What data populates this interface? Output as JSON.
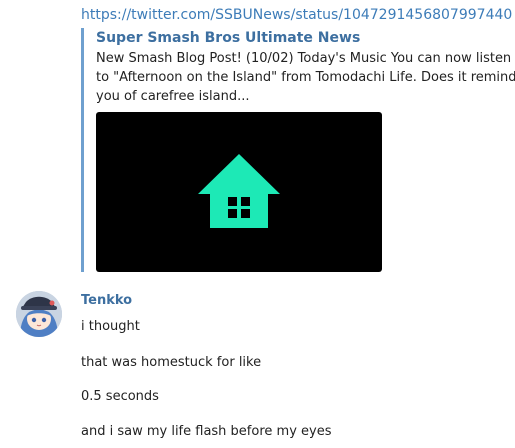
{
  "link": {
    "url_text": "https://twitter.com/SSBUNews/status/1047291456807997440"
  },
  "embed": {
    "title": "Super Smash Bros Ultimate News",
    "description": "New Smash Blog Post! (10/02) Today's Music You can now listen to \"Afternoon on the Island\" from Tomodachi Life. Does it remind you of carefree island...",
    "image_icon": "house-icon",
    "icon_color": "#1de9b6",
    "accent_color": "#6fa0cf"
  },
  "message": {
    "author": "Tenkko",
    "lines": [
      "i thought",
      "that was homestuck for like",
      "0.5 seconds",
      "and i saw my life flash before my eyes"
    ]
  }
}
